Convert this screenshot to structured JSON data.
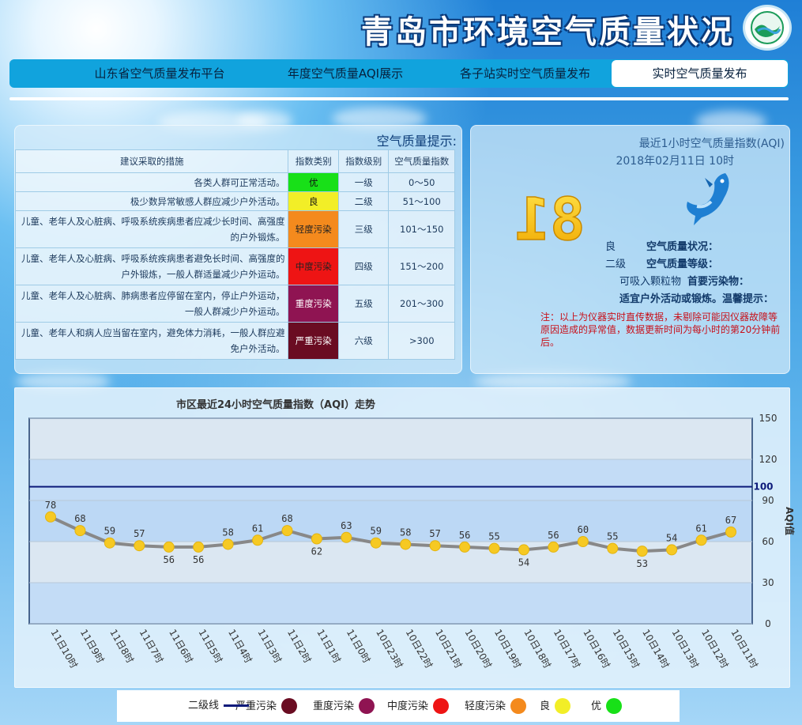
{
  "header": {
    "title": "青岛市环境空气质量状况",
    "logo_icon": "environment-logo-icon"
  },
  "nav": {
    "tabs": [
      {
        "label": "实时空气质量发布",
        "active": true
      },
      {
        "label": "各子站实时空气质量发布",
        "active": false
      },
      {
        "label": "年度空气质量AQI展示",
        "active": false
      },
      {
        "label": "山东省空气质量发布平台",
        "active": false
      }
    ]
  },
  "hint_panel": {
    "title": "空气质量提示:",
    "headers": [
      "空气质量指数",
      "指数级别",
      "指数类别",
      "建议采取的措施"
    ],
    "rows": [
      {
        "range": "0～50",
        "level": "一级",
        "category": "优",
        "color": "#18e018",
        "text_color": "#111111",
        "advice": "各类人群可正常活动。"
      },
      {
        "range": "51～100",
        "level": "二级",
        "category": "良",
        "color": "#f2ee27",
        "text_color": "#111111",
        "advice": "极少数异常敏感人群应减少户外活动。"
      },
      {
        "range": "101～150",
        "level": "三级",
        "category": "轻度污染",
        "color": "#f48a1d",
        "text_color": "#222222",
        "advice": "儿童、老年人及心脏病、呼吸系统疾病患者应减少长时间、高强度的户外锻炼。"
      },
      {
        "range": "151～200",
        "level": "四级",
        "category": "中度污染",
        "color": "#ee1414",
        "text_color": "#222222",
        "advice": "儿童、老年人及心脏病、呼吸系统疾病患者避免长时间、高强度的户外锻炼，一般人群适量减少户外运动。"
      },
      {
        "range": "201～300",
        "level": "五级",
        "category": "重度污染",
        "color": "#8f1452",
        "text_color": "#ffffff",
        "advice": "儿童、老年人及心脏病、肺病患者应停留在室内，停止户外运动，一般人群减少户外运动。"
      },
      {
        "range": ">300",
        "level": "六级",
        "category": "严重污染",
        "color": "#6a0c22",
        "text_color": "#ffffff",
        "advice": "儿童、老年人和病人应当留在室内，避免体力消耗，一般人群应避免户外活动。"
      }
    ]
  },
  "aqi_panel": {
    "heading": "最近1小时空气质量指数(AQI)",
    "time": "2018年02月11日 10时",
    "aqi_value": "81",
    "mascot_icon": "dolphin-mascot-icon",
    "quality_label": "空气质量状况：",
    "quality_value": "良",
    "level_label": "空气质量等级：",
    "level_value": "二级",
    "pollutant_label": "首要污染物：",
    "pollutant_value": "可吸入颗粒物",
    "tip_label": "温馨提示：",
    "tip_value": "适宜户外活动或锻炼。",
    "note": "注：以上为仪器实时直传数据，未剔除可能因仪器故障等原因造成的异常值，数据更新时间为每小时的第20分钟前后。"
  },
  "chart_panel": {
    "title": "市区最近24小时空气质量指数（AQI）走势"
  },
  "chart_data": {
    "type": "line",
    "title": "市区最近24小时空气质量指数（AQI）走势",
    "ylabel": "AQI值",
    "xlabel": "",
    "ylim": [
      0,
      150
    ],
    "yticks": [
      0,
      30,
      60,
      90,
      120,
      150
    ],
    "reference_line": {
      "value": 100,
      "label": "100",
      "color": "#0d1a7a"
    },
    "categories": [
      "11日10时",
      "11日9时",
      "11日8时",
      "11日7时",
      "11日6时",
      "11日5时",
      "11日4时",
      "11日3时",
      "11日2时",
      "11日1时",
      "11日0时",
      "10日23时",
      "10日22时",
      "10日21时",
      "10日20时",
      "10日19时",
      "10日18时",
      "10日17时",
      "10日16时",
      "10日15时",
      "10日14时",
      "10日13时",
      "10日12时",
      "10日11时"
    ],
    "series": [
      {
        "values": [
          78,
          68,
          59,
          57,
          56,
          56,
          58,
          61,
          68,
          62,
          63,
          59,
          58,
          57,
          56,
          55,
          54,
          56,
          60,
          55,
          53,
          54,
          61,
          67
        ]
      }
    ],
    "band_colors": [
      "#c3dcf6",
      "#dbe7f2",
      "#bcd8f5"
    ],
    "point_color": "#f6c923",
    "line_color": "#888888",
    "grid": true
  },
  "legend": {
    "items": [
      {
        "label": "优",
        "color": "#18e018"
      },
      {
        "label": "良",
        "color": "#f2ee27"
      },
      {
        "label": "轻度污染",
        "color": "#f48a1d"
      },
      {
        "label": "中度污染",
        "color": "#ee1414"
      },
      {
        "label": "重度污染",
        "color": "#8f1452"
      },
      {
        "label": "严重污染",
        "color": "#6a0c22"
      }
    ],
    "line_label": "二级线",
    "line_color": "#0d1a7a"
  }
}
